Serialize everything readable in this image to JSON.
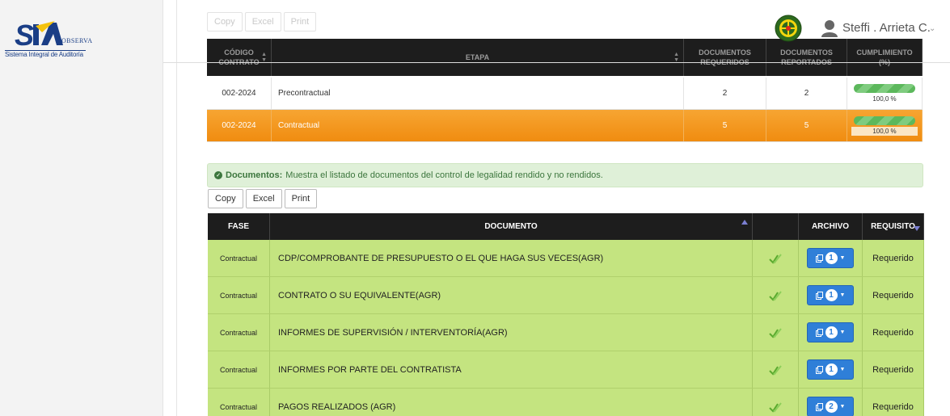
{
  "brand": {
    "logo_text": "SIA",
    "observa": "OBSERVA",
    "tagline": "Sistema Integral de Auditoría",
    "colors": {
      "primary": "#1a3e86",
      "accent": "#f4c20d"
    }
  },
  "user": {
    "name": "Steffi . Arrieta C.",
    "caret": "⌄"
  },
  "top_table": {
    "buttons": {
      "copy": "Copy",
      "excel": "Excel",
      "print": "Print"
    },
    "headers": {
      "codigo": "CÓDIGO CONTRATO",
      "etapa": "ETAPA",
      "requeridos": "DOCUMENTOS REQUERIDOS",
      "reportados": "DOCUMENTOS REPORTADOS",
      "cumplimiento": "CUMPLIMIENTO (%)"
    },
    "rows": [
      {
        "codigo": "002-2024",
        "etapa": "Precontractual",
        "requeridos": "2",
        "reportados": "2",
        "cumplimiento": "100,0 %",
        "progress": 100
      },
      {
        "codigo": "002-2024",
        "etapa": "Contractual",
        "requeridos": "5",
        "reportados": "5",
        "cumplimiento": "100,0 %",
        "progress": 100
      }
    ]
  },
  "alert": {
    "title": "Documentos:",
    "text": " Muestra el listado de documentos del control de legalidad rendido y no rendidos."
  },
  "docs_table": {
    "buttons": {
      "copy": "Copy",
      "excel": "Excel",
      "print": "Print"
    },
    "headers": {
      "fase": "FASE",
      "documento": "DOCUMENTO",
      "archivo": "ARCHIVO",
      "requisito": "REQUISITO"
    },
    "rows": [
      {
        "fase": "Contractual",
        "documento": "CDP/COMPROBANTE DE PRESUPUESTO O EL QUE HAGA SUS VECES(AGR)",
        "archivo_count": "1",
        "requisito": "Requerido"
      },
      {
        "fase": "Contractual",
        "documento": "CONTRATO O SU EQUIVALENTE(AGR)",
        "archivo_count": "1",
        "requisito": "Requerido"
      },
      {
        "fase": "Contractual",
        "documento": "INFORMES DE SUPERVISIÓN / INTERVENTORÍA(AGR)",
        "archivo_count": "1",
        "requisito": "Requerido"
      },
      {
        "fase": "Contractual",
        "documento": "INFORMES POR PARTE DEL CONTRATISTA",
        "archivo_count": "1",
        "requisito": "Requerido"
      },
      {
        "fase": "Contractual",
        "documento": "PAGOS REALIZADOS (AGR)",
        "archivo_count": "2",
        "requisito": "Requerido"
      }
    ]
  }
}
